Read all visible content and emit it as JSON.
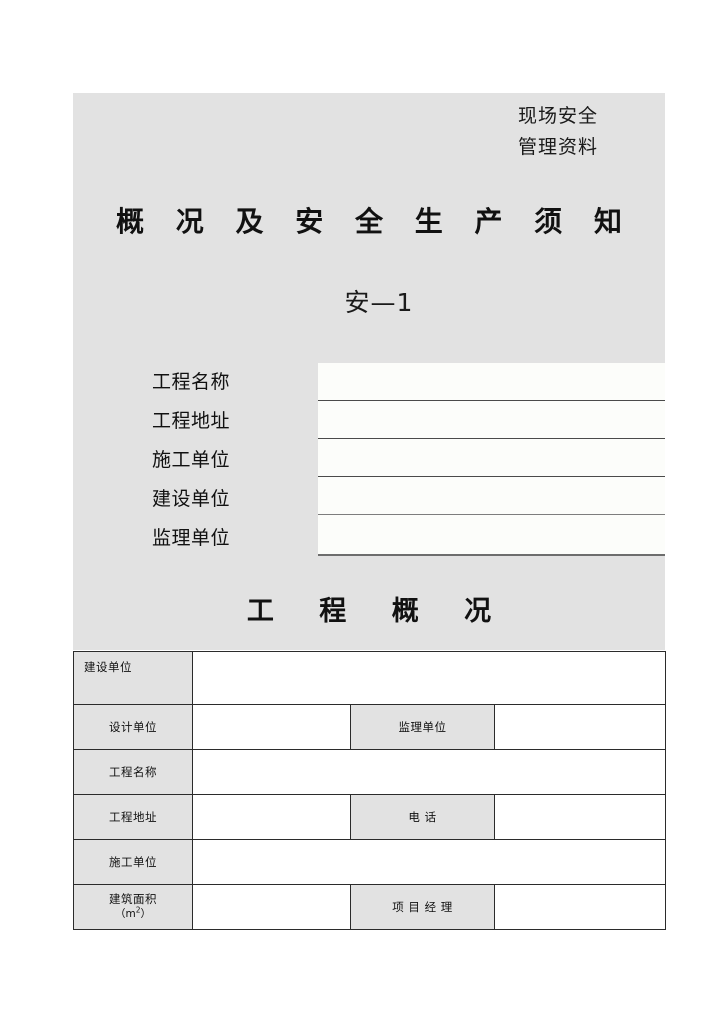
{
  "document": {
    "banner_lines": [
      "现场安全",
      "管理资料"
    ],
    "main_title": "概 况 及 安 全 生 产 须 知",
    "doc_code": "安—1",
    "section_title": "工 程 概 况"
  },
  "fill_form": {
    "labels": [
      "工程名称",
      "工程地址",
      "施工单位",
      "建设单位",
      "监理单位"
    ],
    "values": [
      "",
      "",
      "",
      "",
      ""
    ]
  },
  "overview_table": {
    "rows": [
      {
        "label1": "建设单位",
        "value1": "",
        "label2": null,
        "value2": null,
        "label1_align": "left",
        "span": true
      },
      {
        "label1": "设计单位",
        "value1": "",
        "label2": "监理单位",
        "value2": "",
        "label1_align": "center",
        "span": false
      },
      {
        "label1": "工程名称",
        "value1": "",
        "label2": null,
        "value2": null,
        "label1_align": "center",
        "span": true
      },
      {
        "label1": "工程地址",
        "value1": "",
        "label2": "电  话",
        "value2": "",
        "label1_align": "center",
        "span": false
      },
      {
        "label1": "施工单位",
        "value1": "",
        "label2": null,
        "value2": null,
        "label1_align": "center",
        "span": true
      },
      {
        "label1": "建筑面积",
        "label1_sub": "（m²）",
        "value1": "",
        "label2": "项 目 经 理",
        "value2": "",
        "label1_align": "center",
        "span": false
      }
    ]
  },
  "colors": {
    "shaded_block": "#e2e2e2",
    "table_border": "#2b2b2b",
    "page_background": "#ffffff",
    "text": "#111111"
  }
}
